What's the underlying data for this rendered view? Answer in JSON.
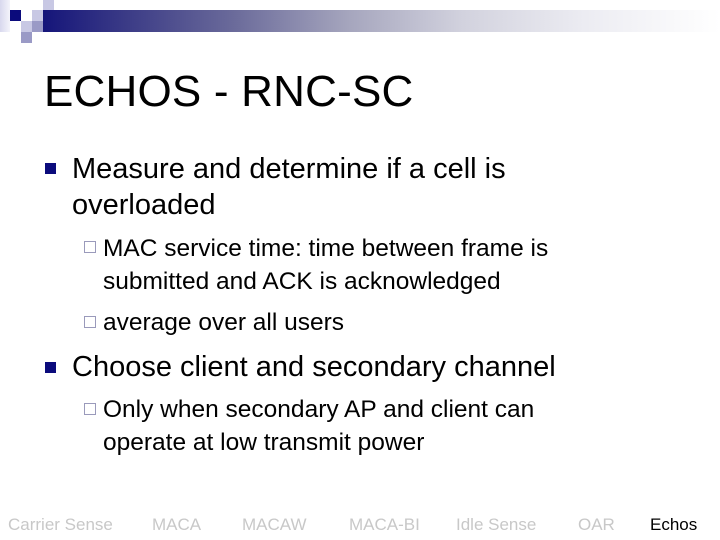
{
  "header": {
    "logo_icon": "squares-logo-icon",
    "colors": {
      "accent_navy": "#0b0b7c",
      "logo_light": "#c8c8e4",
      "logo_mid": "#9a9ac6",
      "sub_bullet": "#9a9abb",
      "nav_inactive": "#c8c8c8",
      "nav_active": "#000000"
    }
  },
  "slide": {
    "title": "ECHOS - RNC-SC",
    "bullets": [
      {
        "lines": [
          "Measure and determine if a cell is",
          "overloaded"
        ],
        "sub_bullets": [
          {
            "lines": [
              "MAC service time: time between frame is",
              "submitted and ACK is acknowledged"
            ]
          },
          {
            "lines": [
              "average over all users"
            ]
          }
        ]
      },
      {
        "lines": [
          "Choose client and secondary channel"
        ],
        "sub_bullets": [
          {
            "lines": [
              "Only when secondary AP and client can",
              "operate at low transmit power"
            ]
          }
        ]
      }
    ]
  },
  "footer_nav": {
    "items": [
      {
        "label": "Carrier Sense",
        "active": false
      },
      {
        "label": "MACA",
        "active": false
      },
      {
        "label": "MACAW",
        "active": false
      },
      {
        "label": "MACA-BI",
        "active": false
      },
      {
        "label": "Idle Sense",
        "active": false
      },
      {
        "label": "OAR",
        "active": false
      },
      {
        "label": "Echos",
        "active": true
      }
    ]
  }
}
